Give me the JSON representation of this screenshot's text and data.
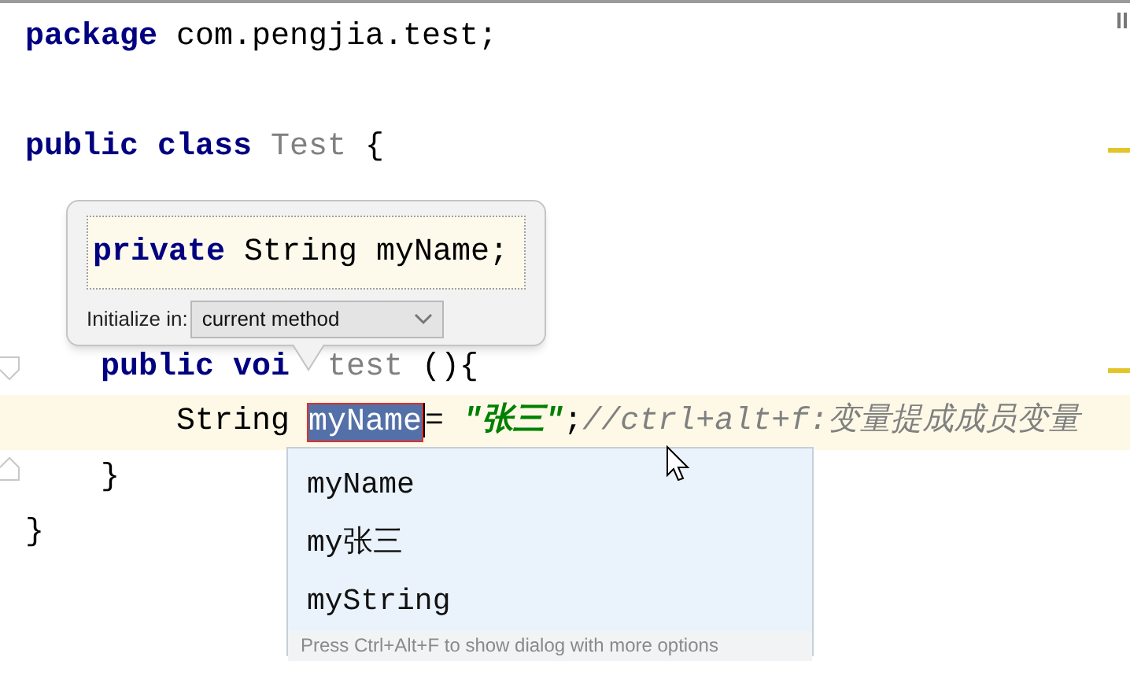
{
  "editor": {
    "lines": [
      {
        "current": false,
        "tokens": [
          {
            "kind": "keyword",
            "text": "package"
          },
          {
            "kind": "plain",
            "text": " com.pengjia.test;"
          }
        ]
      },
      {
        "current": false
      },
      {
        "current": false,
        "tokens": [
          {
            "kind": "keyword",
            "text": "public class"
          },
          {
            "kind": "muted",
            "text": " Test"
          },
          {
            "kind": "plain",
            "text": " {"
          }
        ]
      },
      {
        "current": false
      },
      {
        "current": false
      },
      {
        "current": false
      },
      {
        "current": false,
        "tokens": [
          {
            "kind": "keyword",
            "text": "    public voi"
          },
          {
            "kind": "muted",
            "text": "test",
            "gap": true
          },
          {
            "kind": "plain",
            "text": " (){"
          }
        ]
      },
      {
        "current": true,
        "tokens": [
          {
            "kind": "plain",
            "text": "        String "
          },
          {
            "kind": "selected",
            "text": "myName"
          },
          {
            "kind": "plain",
            "text": "= "
          },
          {
            "kind": "string",
            "text": "\"张三\""
          },
          {
            "kind": "plain",
            "text": ";"
          },
          {
            "kind": "comment",
            "text": "//ctrl+alt+f:变量提成成员变量"
          }
        ]
      },
      {
        "current": false,
        "tokens": [
          {
            "kind": "plain",
            "text": "    }"
          }
        ]
      },
      {
        "current": false,
        "tokens": [
          {
            "kind": "plain",
            "text": "}"
          }
        ]
      }
    ]
  },
  "introduce_field_popup": {
    "preview": {
      "tokens": [
        {
          "kind": "keyword",
          "text": "private"
        },
        {
          "kind": "plain",
          "text": " String myName;"
        }
      ]
    },
    "label": "Initialize in:",
    "dropdown": {
      "value": "current method"
    }
  },
  "suggestions": {
    "items": [
      "myName",
      "my张三",
      "myString"
    ],
    "hint": "Press Ctrl+Alt+F to show dialog with more options"
  }
}
